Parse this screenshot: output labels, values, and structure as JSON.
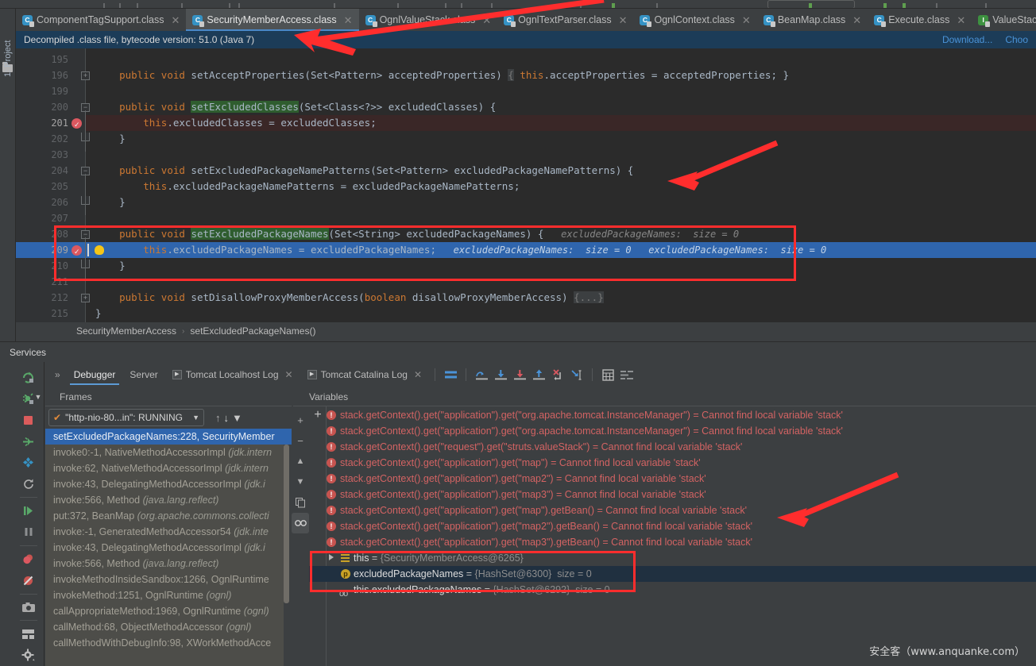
{
  "window": {
    "theme_bg": "#3c3f41",
    "editor_bg": "#2b2b2b",
    "accent": "#4a88c7",
    "annotation_color": "#ff2d2d"
  },
  "project_stripe": {
    "label": "1: Project"
  },
  "tabs": [
    {
      "label": "ComponentTagSupport.class",
      "icon": "java-class-icon",
      "kind": "class",
      "active": false
    },
    {
      "label": "SecurityMemberAccess.class",
      "icon": "java-class-icon",
      "kind": "class",
      "active": true
    },
    {
      "label": "OgnlValueStack.class",
      "icon": "java-class-icon",
      "kind": "class",
      "active": false
    },
    {
      "label": "OgnlTextParser.class",
      "icon": "java-class-icon",
      "kind": "class",
      "active": false
    },
    {
      "label": "OgnlContext.class",
      "icon": "java-class-icon",
      "kind": "class",
      "active": false
    },
    {
      "label": "BeanMap.class",
      "icon": "java-class-icon",
      "kind": "class",
      "active": false
    },
    {
      "label": "Execute.class",
      "icon": "java-class-icon",
      "kind": "class",
      "active": false
    },
    {
      "label": "ValueStack.c",
      "icon": "java-interface-icon",
      "kind": "interface",
      "active": false
    }
  ],
  "notification": {
    "message": "Decompiled .class file, bytecode version: 51.0 (Java 7)",
    "actions": [
      "Download...",
      "Choo"
    ]
  },
  "editor": {
    "lines": [
      {
        "num": "195",
        "tokens": [],
        "fold": "",
        "state": ""
      },
      {
        "num": "196",
        "fold": "plus",
        "state": "",
        "tokens": [
          {
            "t": "    ",
            "c": "txt"
          },
          {
            "t": "public",
            "c": "kw"
          },
          {
            "t": " ",
            "c": "txt"
          },
          {
            "t": "void",
            "c": "kw"
          },
          {
            "t": " setAcceptProperties(Set<Pattern> acceptedProperties) ",
            "c": "id"
          },
          {
            "t": "{",
            "c": "fold-inl"
          },
          {
            "t": " ",
            "c": "txt"
          },
          {
            "t": "this",
            "c": "kw"
          },
          {
            "t": ".acceptProperties = acceptedProperties;",
            "c": "id"
          },
          {
            "t": " ",
            "c": "txt"
          },
          {
            "t": "}",
            "c": "id"
          }
        ]
      },
      {
        "num": "199",
        "tokens": [],
        "fold": "",
        "state": ""
      },
      {
        "num": "200",
        "fold": "minus",
        "state": "",
        "tokens": [
          {
            "t": "    ",
            "c": "txt"
          },
          {
            "t": "public",
            "c": "kw"
          },
          {
            "t": " ",
            "c": "txt"
          },
          {
            "t": "void",
            "c": "kw"
          },
          {
            "t": " ",
            "c": "txt"
          },
          {
            "t": "setExcludedClasses",
            "c": "mname"
          },
          {
            "t": "(Set<Class<?>> excludedClasses) {",
            "c": "id"
          }
        ]
      },
      {
        "num": "201",
        "fold": "",
        "state": "exec",
        "breakpoint": true,
        "tokens": [
          {
            "t": "        ",
            "c": "txt"
          },
          {
            "t": "this",
            "c": "kw"
          },
          {
            "t": ".excludedClasses = excludedClasses;",
            "c": "id"
          }
        ]
      },
      {
        "num": "202",
        "fold": "end",
        "state": "",
        "tokens": [
          {
            "t": "    }",
            "c": "id"
          }
        ]
      },
      {
        "num": "203",
        "tokens": [],
        "fold": "",
        "state": ""
      },
      {
        "num": "204",
        "fold": "minus",
        "state": "",
        "tokens": [
          {
            "t": "    ",
            "c": "txt"
          },
          {
            "t": "public",
            "c": "kw"
          },
          {
            "t": " ",
            "c": "txt"
          },
          {
            "t": "void",
            "c": "kw"
          },
          {
            "t": " setExcludedPackageNamePatterns(Set<Pattern> excludedPackageNamePatterns) {",
            "c": "id"
          }
        ]
      },
      {
        "num": "205",
        "fold": "",
        "state": "",
        "tokens": [
          {
            "t": "        ",
            "c": "txt"
          },
          {
            "t": "this",
            "c": "kw"
          },
          {
            "t": ".excludedPackageNamePatterns = excludedPackageNamePatterns;",
            "c": "id"
          }
        ]
      },
      {
        "num": "206",
        "fold": "end",
        "state": "",
        "tokens": [
          {
            "t": "    }",
            "c": "id"
          }
        ]
      },
      {
        "num": "207",
        "tokens": [],
        "fold": "",
        "state": ""
      },
      {
        "num": "208",
        "fold": "minus",
        "state": "",
        "tokens": [
          {
            "t": "    ",
            "c": "txt"
          },
          {
            "t": "public",
            "c": "kw"
          },
          {
            "t": " ",
            "c": "txt"
          },
          {
            "t": "void",
            "c": "kw"
          },
          {
            "t": " ",
            "c": "txt"
          },
          {
            "t": "setExcludedPackageNames",
            "c": "mname"
          },
          {
            "t": "(Set<String> excludedPackageNames) {",
            "c": "id"
          }
        ],
        "hint": "excludedPackageNames:  size = 0"
      },
      {
        "num": "209",
        "fold": "",
        "state": "sel",
        "breakpoint": true,
        "bulb": true,
        "caret": true,
        "tokens": [
          {
            "t": "        ",
            "c": "txt"
          },
          {
            "t": "this",
            "c": "kw"
          },
          {
            "t": ".excludedPackageNames = excludedPackageNames;",
            "c": "id"
          }
        ],
        "hint": "excludedPackageNames:  size = 0   excludedPackageNames:  size = 0"
      },
      {
        "num": "210",
        "fold": "end",
        "state": "",
        "tokens": [
          {
            "t": "    }",
            "c": "id"
          }
        ]
      },
      {
        "num": "211",
        "tokens": [],
        "fold": "",
        "state": ""
      },
      {
        "num": "212",
        "fold": "plus",
        "state": "",
        "tokens": [
          {
            "t": "    ",
            "c": "txt"
          },
          {
            "t": "public",
            "c": "kw"
          },
          {
            "t": " ",
            "c": "txt"
          },
          {
            "t": "void",
            "c": "kw"
          },
          {
            "t": " setDisallowProxyMemberAccess(",
            "c": "id"
          },
          {
            "t": "boolean",
            "c": "kw"
          },
          {
            "t": " disallowProxyMemberAccess) ",
            "c": "id"
          },
          {
            "t": "{...}",
            "c": "fold-inl"
          }
        ]
      },
      {
        "num": "215",
        "fold": "",
        "state": "",
        "tokens": [
          {
            "t": "}",
            "c": "id"
          }
        ]
      }
    ]
  },
  "breadcrumb": {
    "class": "SecurityMemberAccess",
    "method": "setExcludedPackageNames()",
    "separator": "›"
  },
  "services": {
    "title": "Services"
  },
  "debugger": {
    "overflow_label": "»",
    "tabs": [
      {
        "label": "Debugger",
        "active": true,
        "closable": false,
        "icon": null
      },
      {
        "label": "Server",
        "active": false,
        "closable": false,
        "icon": null
      },
      {
        "label": "Tomcat Localhost Log",
        "active": false,
        "closable": true,
        "icon": "run-icon"
      },
      {
        "label": "Tomcat Catalina Log",
        "active": false,
        "closable": true,
        "icon": "run-icon"
      }
    ],
    "toolbar_icons": [
      "layout-icon",
      "step-over-icon",
      "step-into-icon",
      "force-step-into-icon",
      "step-out-icon",
      "drop-frame-icon",
      "run-to-cursor-icon",
      "evaluate-expression-icon",
      "settings-lines-icon"
    ]
  },
  "panes": {
    "frames_header": "Frames",
    "variables_header": "Variables"
  },
  "frames": {
    "thread_selector": {
      "value": "\"http-nio-80...in\": RUNNING",
      "status_icon": "check-icon",
      "dropdown_icon": "chevron-down-icon"
    },
    "toolbar_icons": [
      "up-arrow-icon",
      "down-arrow-icon",
      "filter-icon"
    ],
    "side_icons": [
      "plus-icon",
      "minus-icon",
      "up-icon",
      "down-icon",
      "copy-icon",
      "watch-icon"
    ],
    "items": [
      {
        "text": "setExcludedPackageNames:228, SecurityMember",
        "pkg": "",
        "selected": true
      },
      {
        "text": "invoke0:-1, NativeMethodAccessorImpl ",
        "pkg": "(jdk.intern",
        "selected": false
      },
      {
        "text": "invoke:62, NativeMethodAccessorImpl ",
        "pkg": "(jdk.intern",
        "selected": false
      },
      {
        "text": "invoke:43, DelegatingMethodAccessorImpl ",
        "pkg": "(jdk.i",
        "selected": false
      },
      {
        "text": "invoke:566, Method ",
        "pkg": "(java.lang.reflect)",
        "selected": false
      },
      {
        "text": "put:372, BeanMap ",
        "pkg": "(org.apache.commons.collecti",
        "selected": false
      },
      {
        "text": "invoke:-1, GeneratedMethodAccessor54 ",
        "pkg": "(jdk.inte",
        "selected": false
      },
      {
        "text": "invoke:43, DelegatingMethodAccessorImpl ",
        "pkg": "(jdk.i",
        "selected": false
      },
      {
        "text": "invoke:566, Method ",
        "pkg": "(java.lang.reflect)",
        "selected": false
      },
      {
        "text": "invokeMethodInsideSandbox:1266, OgnlRuntime",
        "pkg": "",
        "selected": false
      },
      {
        "text": "invokeMethod:1251, OgnlRuntime ",
        "pkg": "(ognl)",
        "selected": false
      },
      {
        "text": "callAppropriateMethod:1969, OgnlRuntime ",
        "pkg": "(ognl)",
        "selected": false
      },
      {
        "text": "callMethod:68, ObjectMethodAccessor ",
        "pkg": "(ognl)",
        "selected": false
      },
      {
        "text": "callMethodWithDebugInfo:98, XWorkMethodAcce",
        "pkg": "",
        "selected": false
      }
    ]
  },
  "variables": {
    "add_button": "+",
    "watches": [
      {
        "kind": "error",
        "expr": "stack.getContext().get(\"application\").get(\"org.apache.tomcat.InstanceManager\")",
        "error": "Cannot find local variable 'stack'"
      },
      {
        "kind": "error",
        "expr": "stack.getContext().get(\"application\").get(\"org.apache.tomcat.InstanceManager\")",
        "error": "Cannot find local variable 'stack'"
      },
      {
        "kind": "error",
        "expr": "stack.getContext().get(\"request\").get(\"struts.valueStack\")",
        "error": "Cannot find local variable 'stack'"
      },
      {
        "kind": "error",
        "expr": "stack.getContext().get(\"application\").get(\"map\")",
        "error": "Cannot find local variable 'stack'"
      },
      {
        "kind": "error",
        "expr": "stack.getContext().get(\"application\").get(\"map2\")",
        "error": "Cannot find local variable 'stack'"
      },
      {
        "kind": "error",
        "expr": "stack.getContext().get(\"application\").get(\"map3\")",
        "error": "Cannot find local variable 'stack'"
      },
      {
        "kind": "error",
        "expr": "stack.getContext().get(\"application\").get(\"map\").getBean()",
        "error": "Cannot find local variable 'stack'"
      },
      {
        "kind": "error",
        "expr": "stack.getContext().get(\"application\").get(\"map2\").getBean()",
        "error": "Cannot find local variable 'stack'"
      },
      {
        "kind": "error",
        "expr": "stack.getContext().get(\"application\").get(\"map3\").getBean()",
        "error": "Cannot find local variable 'stack'"
      },
      {
        "kind": "object",
        "name": "this",
        "value": "{SecurityMemberAccess@6265}",
        "expandable": true
      },
      {
        "kind": "field",
        "name": "excludedPackageNames",
        "value": "{HashSet@6300}",
        "extra": "size = 0"
      },
      {
        "kind": "field2",
        "name": "this.excludedPackageNames",
        "value": "{HashSet@6292}",
        "extra": "size = 0"
      }
    ]
  },
  "watermark": {
    "text": "安全客（www.anquanke.com）"
  }
}
